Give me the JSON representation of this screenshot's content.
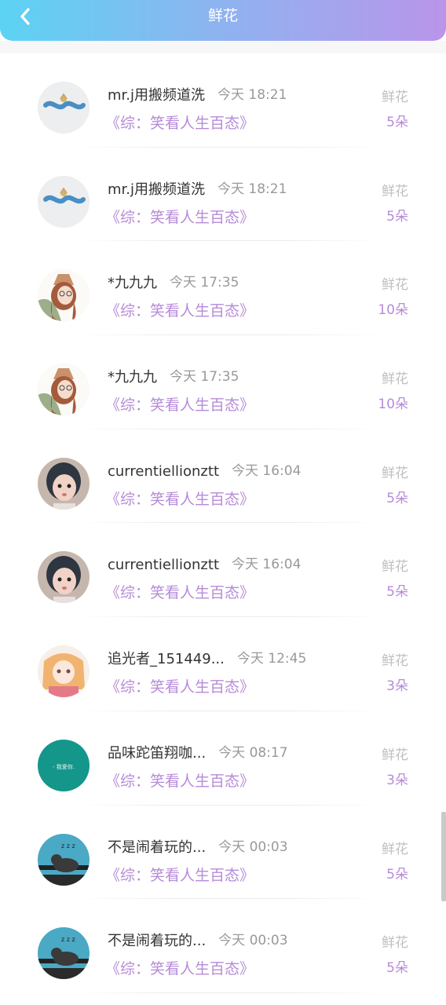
{
  "header": {
    "title": "鲜花",
    "back_icon": "chevron-left-icon",
    "gradient": [
      "#5cd3f3",
      "#b995ea"
    ]
  },
  "colors": {
    "accent": "#b68bd8",
    "muted": "#bfbfbf",
    "name": "#333333",
    "time": "#999999"
  },
  "records": [
    {
      "name": "mr.j用搬频道洗",
      "time": "今天 18:21",
      "work": "《综：笑看人生百态》",
      "gift_label": "鲜花",
      "gift_count": "5朵",
      "avatar": "bracelet-avatar"
    },
    {
      "name": "mr.j用搬频道洗",
      "time": "今天 18:21",
      "work": "《综：笑看人生百态》",
      "gift_label": "鲜花",
      "gift_count": "5朵",
      "avatar": "bracelet-avatar"
    },
    {
      "name": "*九九九",
      "time": "今天 17:35",
      "work": "《综：笑看人生百态》",
      "gift_label": "鲜花",
      "gift_count": "10朵",
      "avatar": "girl-hat-avatar"
    },
    {
      "name": "*九九九",
      "time": "今天 17:35",
      "work": "《综：笑看人生百态》",
      "gift_label": "鲜花",
      "gift_count": "10朵",
      "avatar": "girl-hat-avatar"
    },
    {
      "name": "currentiellionztt",
      "time": "今天 16:04",
      "work": "《综：笑看人生百态》",
      "gift_label": "鲜花",
      "gift_count": "5朵",
      "avatar": "child-photo-avatar"
    },
    {
      "name": "currentiellionztt",
      "time": "今天 16:04",
      "work": "《综：笑看人生百态》",
      "gift_label": "鲜花",
      "gift_count": "5朵",
      "avatar": "child-photo-avatar"
    },
    {
      "name": "追光者_151449...",
      "time": "今天 12:45",
      "work": "《综：笑看人生百态》",
      "gift_label": "鲜花",
      "gift_count": "3朵",
      "avatar": "anime-girl-avatar"
    },
    {
      "name": "品味跎笛翔咖...",
      "time": "今天 08:17",
      "work": "《综：笑看人生百态》",
      "gift_label": "鲜花",
      "gift_count": "3朵",
      "avatar": "teal-text-avatar",
      "avatar_text": "- 我爱你."
    },
    {
      "name": "不是闹着玩的...",
      "time": "今天 00:03",
      "work": "《综：笑看人生百态》",
      "gift_label": "鲜花",
      "gift_count": "5朵",
      "avatar": "sleeping-bird-avatar"
    },
    {
      "name": "不是闹着玩的...",
      "time": "今天 00:03",
      "work": "《综：笑看人生百态》",
      "gift_label": "鲜花",
      "gift_count": "5朵",
      "avatar": "sleeping-bird-avatar"
    }
  ]
}
